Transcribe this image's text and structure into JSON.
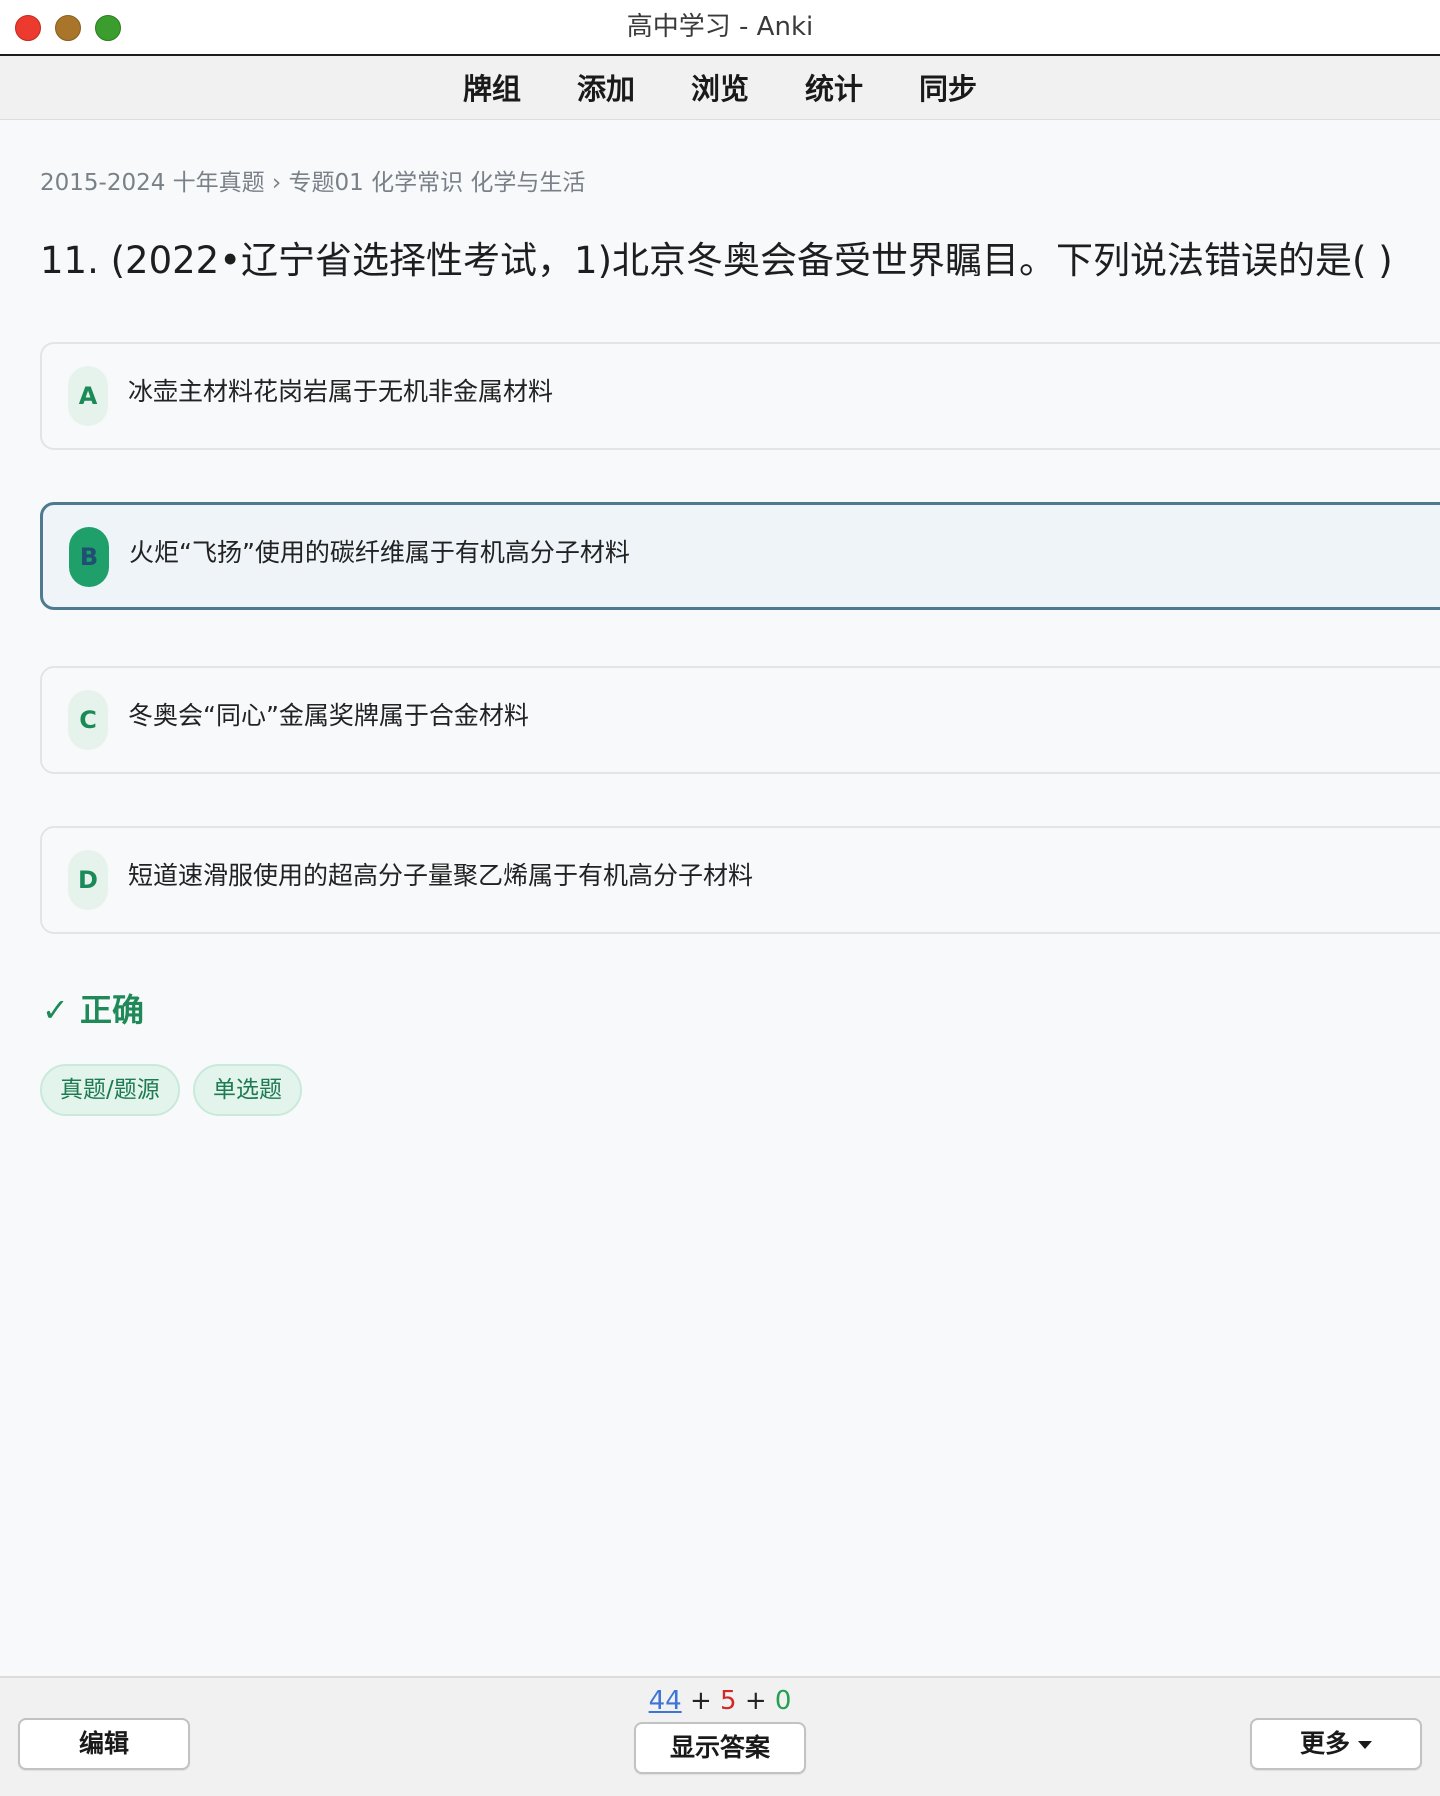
{
  "window": {
    "title": "高中学习 - Anki"
  },
  "toolbar": {
    "items": [
      "牌组",
      "添加",
      "浏览",
      "统计",
      "同步"
    ]
  },
  "card": {
    "breadcrumb": "2015-2024 十年真题 › 专题01 化学常识 化学与生活",
    "question": "11.  (2022•辽宁省选择性考试，1)北京冬奥会备受世界瞩目。下列说法错误的是( )",
    "options": [
      {
        "letter": "A",
        "text": "冰壶主材料花岗岩属于无机非金属材料",
        "selected": false
      },
      {
        "letter": "B",
        "text": "火炬“飞扬”使用的碳纤维属于有机高分子材料",
        "selected": true
      },
      {
        "letter": "C",
        "text": "冬奥会“同心”金属奖牌属于合金材料",
        "selected": false
      },
      {
        "letter": "D",
        "text": "短道速滑服使用的超高分子量聚乙烯属于有机高分子材料",
        "selected": false
      }
    ],
    "result": {
      "icon": "check-icon",
      "text": "正确",
      "glyph": "✓"
    },
    "tags": [
      "真题/题源",
      "单选题"
    ]
  },
  "bottom": {
    "counts": {
      "new": "44",
      "plus1": "+",
      "learn": "5",
      "plus2": "+",
      "review": "0"
    },
    "edit_label": "编辑",
    "show_answer_label": "显示答案",
    "more_label": "更多"
  },
  "colors": {
    "accent_green": "#1f8a57",
    "selected_border": "#4e7a90",
    "new_count": "#3d75d6",
    "learn_count": "#d22828",
    "review_count": "#23a050"
  }
}
